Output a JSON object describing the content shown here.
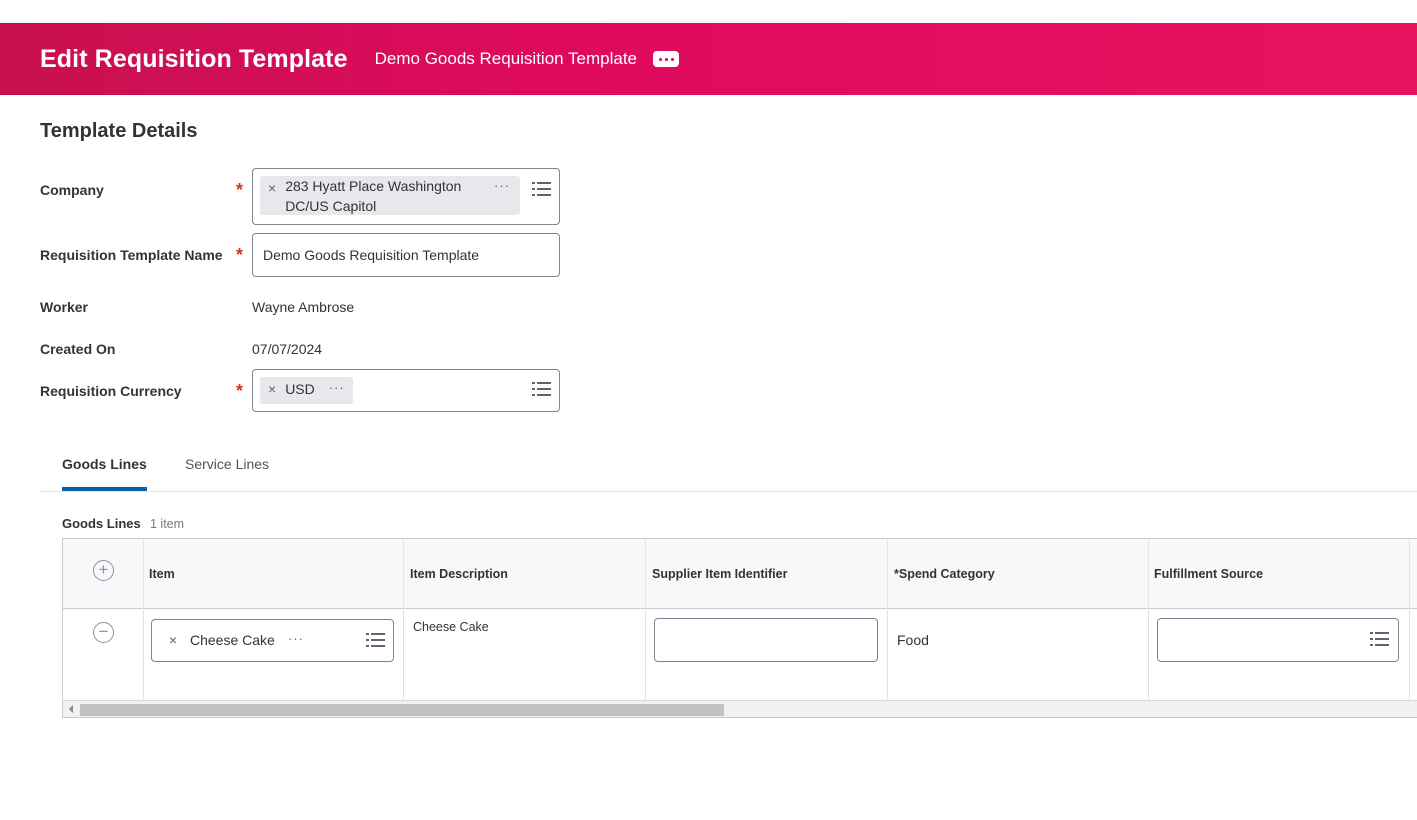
{
  "header": {
    "title": "Edit Requisition Template",
    "subtitle": "Demo Goods Requisition Template",
    "more_icon": "more-options-icon"
  },
  "template_details": {
    "section_title": "Template Details",
    "company": {
      "label": "Company",
      "required_mark": "*",
      "value_line1": "283 Hyatt Place Washington",
      "value_line2": "DC/US Capitol",
      "remove_glyph": "×",
      "more_glyph": "···"
    },
    "template_name": {
      "label": "Requisition Template Name",
      "required_mark": "*",
      "value": "Demo Goods Requisition Template"
    },
    "worker": {
      "label": "Worker",
      "value": "Wayne Ambrose"
    },
    "created_on": {
      "label": "Created On",
      "value": "07/07/2024"
    },
    "currency": {
      "label": "Requisition Currency",
      "required_mark": "*",
      "value": "USD",
      "remove_glyph": "×",
      "more_glyph": "···"
    }
  },
  "tabs": [
    {
      "label": "Goods Lines",
      "active": true
    },
    {
      "label": "Service Lines",
      "active": false
    }
  ],
  "goods_lines": {
    "title": "Goods Lines",
    "count": "1 item",
    "add_glyph": "+",
    "columns": [
      "Item",
      "Item Description",
      "Supplier Item Identifier",
      "*Spend Category",
      "Fulfillment Source"
    ],
    "rows": [
      {
        "remove_glyph": "−",
        "item": "Cheese Cake",
        "item_remove_glyph": "×",
        "item_more_glyph": "···",
        "item_description": "Cheese Cake",
        "supplier_item_identifier": "",
        "spend_category": "Food",
        "fulfillment_source": ""
      }
    ]
  }
}
